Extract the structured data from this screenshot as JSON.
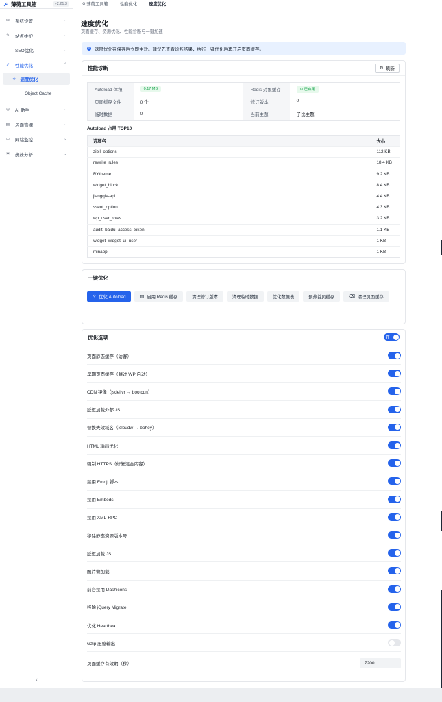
{
  "app": {
    "name": "薄荷工具箱",
    "version": "v2.21.3"
  },
  "sidebar": {
    "items": [
      {
        "label": "系统设置",
        "icon": "gear-icon"
      },
      {
        "label": "站点维护",
        "icon": "wrench-icon"
      },
      {
        "label": "SEO优化",
        "icon": "arrow-up-icon"
      },
      {
        "label": "性能优化",
        "icon": "rocket-icon"
      },
      {
        "label": "AI 助手",
        "icon": "robot-icon"
      },
      {
        "label": "页面管理",
        "icon": "file-icon"
      },
      {
        "label": "网站监控",
        "icon": "monitor-icon"
      },
      {
        "label": "蜘蛛分析",
        "icon": "spider-icon"
      }
    ],
    "sub_items": [
      {
        "label": "速度优化",
        "icon": "sparkle-icon"
      },
      {
        "label": "Object Cache"
      }
    ]
  },
  "breadcrumb": [
    "薄荷工具箱",
    "性能优化",
    "速度优化"
  ],
  "page": {
    "title": "速度优化",
    "subtitle": "页面缓存、资源优化、性能诊断与一键加速"
  },
  "notice": "速度优化在保存后立即生效。建议先查看诊断结果，执行一键优化后再开启页面缓存。",
  "diagnosis": {
    "title": "性能诊断",
    "refresh_label": "刷新",
    "rows": [
      {
        "k1": "Autoload 体积",
        "v1": "0.17 MB",
        "k2": "Redis 对象缓存",
        "v2": "已启用"
      },
      {
        "k1": "页面缓存文件",
        "v1": "0 个",
        "k2": "修订版本",
        "v2": "0"
      },
      {
        "k1": "临时数据",
        "v1": "0",
        "k2": "当前主题",
        "v2": "子比主题"
      }
    ],
    "top10_label": "Autoload 占用 TOP10",
    "top10_headers": [
      "选项名",
      "大小"
    ],
    "top10": [
      {
        "name": "zibll_options",
        "size": "112 KB"
      },
      {
        "name": "rewrite_rules",
        "size": "18.4 KB"
      },
      {
        "name": "RYtheme",
        "size": "9.2 KB"
      },
      {
        "name": "widget_block",
        "size": "8.4 KB"
      },
      {
        "name": "jiangqie-api",
        "size": "4.4 KB"
      },
      {
        "name": "sseot_option",
        "size": "4.3 KB"
      },
      {
        "name": "wp_user_roles",
        "size": "3.2 KB"
      },
      {
        "name": "audit_baidu_access_token",
        "size": "1.1 KB"
      },
      {
        "name": "widget_widget_ui_user",
        "size": "1 KB"
      },
      {
        "name": "minapp",
        "size": "1 KB"
      }
    ]
  },
  "oneclick": {
    "title": "一键优化",
    "buttons": [
      {
        "label": "优化 Autoload",
        "primary": true,
        "icon": "sparkle-icon"
      },
      {
        "label": "启用 Redis 缓存",
        "icon": "database-icon"
      },
      {
        "label": "清理修订版本"
      },
      {
        "label": "清理临时数据"
      },
      {
        "label": "优化数据表"
      },
      {
        "label": "预热首页缓存"
      },
      {
        "label": "清理页面缓存",
        "icon": "trash-icon"
      }
    ]
  },
  "options": {
    "title": "优化选项",
    "master_label": "开",
    "items": [
      {
        "label": "页面静态缓存（访客）",
        "on": true
      },
      {
        "label": "早期页面缓存（跳过 WP 启动）",
        "on": true
      },
      {
        "label": "CDN 镜像（jsdelivr → bootcdn）",
        "on": true
      },
      {
        "label": "延迟加载外部 JS",
        "on": true
      },
      {
        "label": "替换失效域名（icloudw → bohey）",
        "on": true
      },
      {
        "label": "HTML 输出优化",
        "on": true
      },
      {
        "label": "强制 HTTPS（修复混合内容）",
        "on": true
      },
      {
        "label": "禁用 Emoji 脚本",
        "on": true
      },
      {
        "label": "禁用 Embeds",
        "on": true
      },
      {
        "label": "禁用 XML-RPC",
        "on": true
      },
      {
        "label": "移除静态资源版本号",
        "on": true
      },
      {
        "label": "延迟加载 JS",
        "on": true
      },
      {
        "label": "图片懒加载",
        "on": true
      },
      {
        "label": "前台禁用 Dashicons",
        "on": true
      },
      {
        "label": "移除 jQuery Migrate",
        "on": true
      },
      {
        "label": "优化 Heartbeat",
        "on": true
      },
      {
        "label": "Gzip 压缩输出",
        "on": false
      }
    ],
    "ttl_label": "页面缓存有效期（秒）",
    "ttl_value": "7200"
  }
}
